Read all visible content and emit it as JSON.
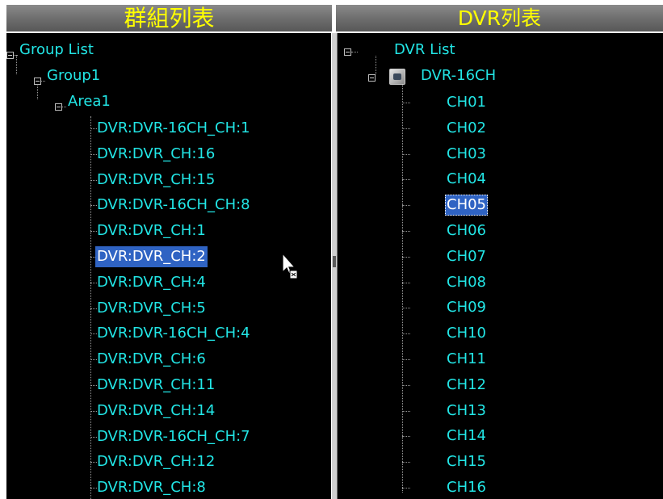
{
  "left_panel": {
    "title": "群組列表",
    "root": "Group List",
    "group": "Group1",
    "area": "Area1",
    "items": [
      "DVR:DVR-16CH_CH:1",
      "DVR:DVR_CH:16",
      "DVR:DVR_CH:15",
      "DVR:DVR-16CH_CH:8",
      "DVR:DVR_CH:1",
      "DVR:DVR_CH:2",
      "DVR:DVR_CH:4",
      "DVR:DVR_CH:5",
      "DVR:DVR-16CH_CH:4",
      "DVR:DVR_CH:6",
      "DVR:DVR_CH:11",
      "DVR:DVR_CH:14",
      "DVR:DVR-16CH_CH:7",
      "DVR:DVR_CH:12",
      "DVR:DVR_CH:8"
    ],
    "selected_index": 5
  },
  "right_panel": {
    "title": "DVR列表",
    "root": "DVR List",
    "dvr": "DVR-16CH",
    "channels": [
      "CH01",
      "CH02",
      "CH03",
      "CH04",
      "CH05",
      "CH06",
      "CH07",
      "CH08",
      "CH09",
      "CH10",
      "CH11",
      "CH12",
      "CH13",
      "CH14",
      "CH15",
      "CH16"
    ],
    "selected_index": 4
  },
  "colors": {
    "header_text": "#ffff00",
    "tree_text": "#22e6e6",
    "selection": "#2f63c3",
    "background": "#000000"
  },
  "icons": {
    "expand": "minus-box-icon",
    "dvr": "dvr-device-icon",
    "cursor": "mouse-pointer-icon"
  }
}
